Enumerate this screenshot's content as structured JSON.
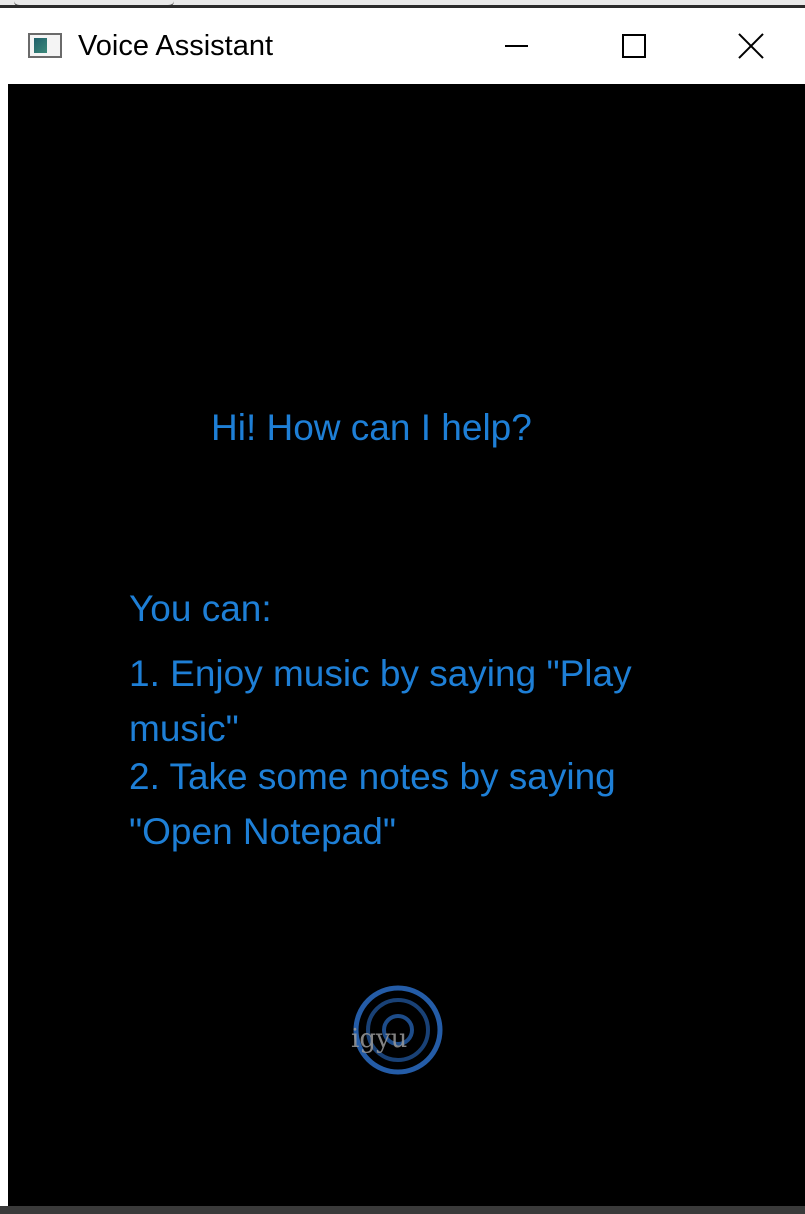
{
  "window": {
    "title": "Voice Assistant",
    "minimize_symbol": "—",
    "maximize_symbol": "☐",
    "close_symbol": "✕"
  },
  "content": {
    "greeting": "Hi! How can I help?",
    "options_title": "You can:",
    "options": [
      "1. Enjoy music by saying \"Play music\"",
      "2. Take some notes by saying \"Open Notepad\""
    ],
    "mic_label": "igyu"
  },
  "colors": {
    "background": "#000000",
    "text": "#1e7fd6",
    "mic_ring": "#2a6cc4",
    "titlebar": "#ffffff"
  },
  "icons": {
    "app": "window-app-icon",
    "mic": "microphone-button-icon"
  }
}
